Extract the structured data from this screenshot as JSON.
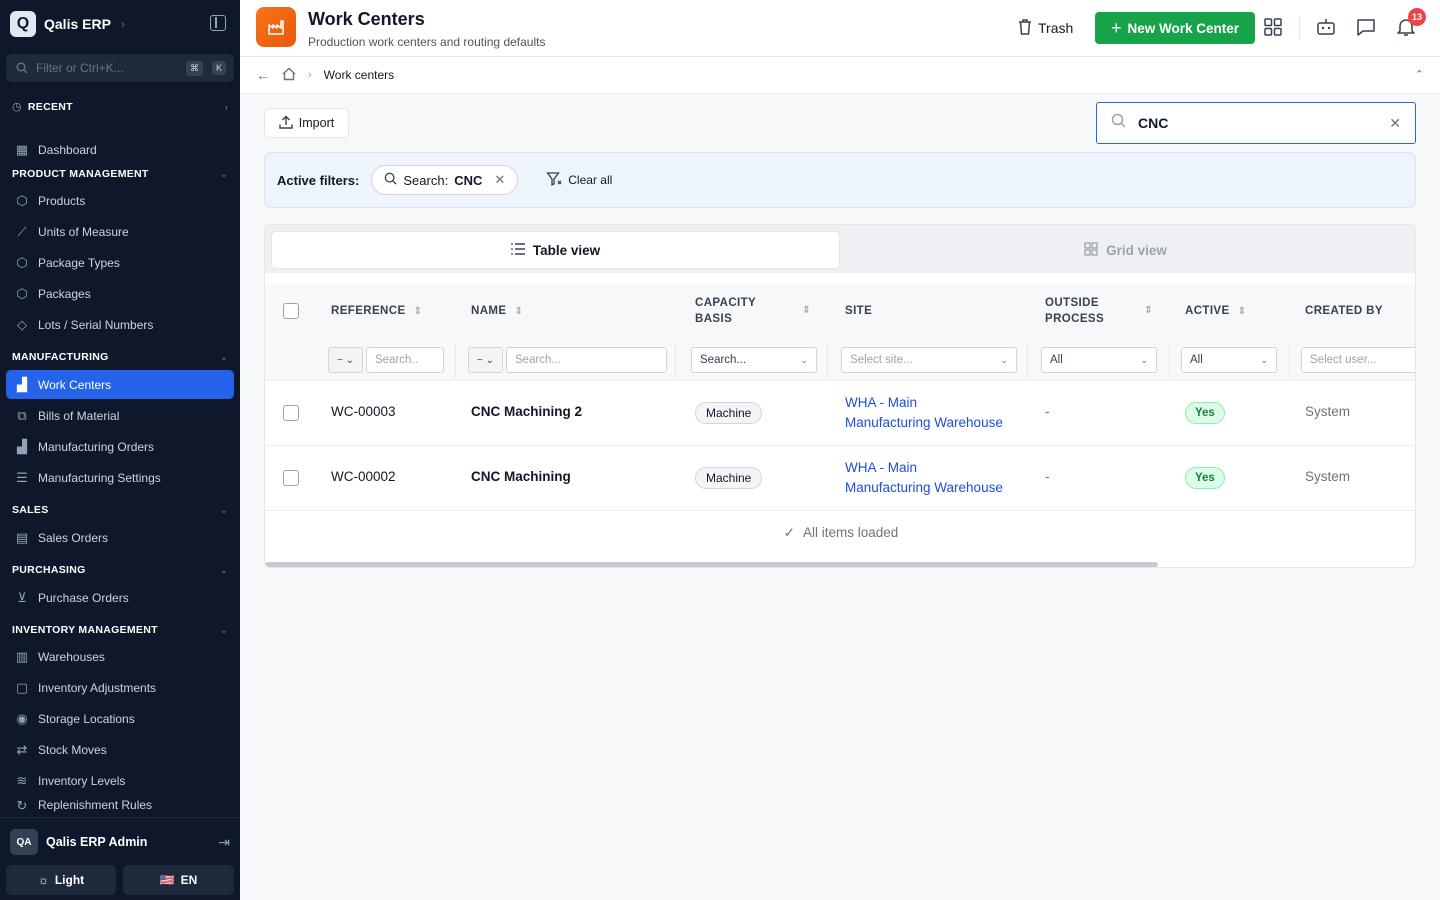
{
  "sidebar": {
    "brand_initial": "Q",
    "brand_name": "Qalis ERP",
    "filter_placeholder": "Filter or Ctrl+K...",
    "kbd_1": "⌘",
    "kbd_2": "K",
    "recent_label": "RECENT",
    "dashboard_label": "Dashboard",
    "sections": {
      "product": "PRODUCT MANAGEMENT",
      "manufacturing": "MANUFACTURING",
      "sales": "SALES",
      "purchasing": "PURCHASING",
      "inventory": "INVENTORY MANAGEMENT"
    },
    "items": {
      "products": "Products",
      "uom": "Units of Measure",
      "package_types": "Package Types",
      "packages": "Packages",
      "lots": "Lots / Serial Numbers",
      "work_centers": "Work Centers",
      "bom": "Bills of Material",
      "mo": "Manufacturing Orders",
      "mfg_settings": "Manufacturing Settings",
      "sales_orders": "Sales Orders",
      "purchase_orders": "Purchase Orders",
      "warehouses": "Warehouses",
      "inv_adjust": "Inventory Adjustments",
      "storage": "Storage Locations",
      "stock_moves": "Stock Moves",
      "inv_levels": "Inventory Levels",
      "replenish": "Replenishment Rules"
    },
    "user_initials": "QA",
    "user_name": "Qalis ERP Admin",
    "theme_label": "Light",
    "lang_flag": "🇺🇸",
    "lang_label": "EN"
  },
  "header": {
    "title": "Work Centers",
    "subtitle": "Production work centers and routing defaults",
    "trash_label": "Trash",
    "new_label": "New Work Center",
    "notif_count": "13"
  },
  "breadcrumb": {
    "current": "Work centers"
  },
  "toolbar": {
    "import_label": "Import",
    "search_value": "CNC"
  },
  "filters": {
    "label": "Active filters:",
    "chip_key": "Search:",
    "chip_value": "CNC",
    "clear_label": "Clear all"
  },
  "views": {
    "table": "Table view",
    "grid": "Grid view"
  },
  "table": {
    "columns": {
      "reference": "REFERENCE",
      "name": "NAME",
      "capacity_1": "CAPACITY",
      "capacity_2": "BASIS",
      "site": "SITE",
      "outside_1": "OUTSIDE",
      "outside_2": "PROCESS",
      "active": "ACTIVE",
      "created_by": "CREATED BY"
    },
    "filters": {
      "op": "~",
      "ref_placeholder": "Search..",
      "name_placeholder": "Search...",
      "capacity_value": "Search...",
      "site_placeholder": "Select site...",
      "outside_value": "All",
      "active_value": "All",
      "user_placeholder": "Select user..."
    },
    "rows": [
      {
        "reference": "WC-00003",
        "name": "CNC Machining 2",
        "capacity": "Machine",
        "site_1": "WHA - Main",
        "site_2": "Manufacturing Warehouse",
        "outside": "-",
        "active": "Yes",
        "created_by": "System"
      },
      {
        "reference": "WC-00002",
        "name": "CNC Machining",
        "capacity": "Machine",
        "site_1": "WHA - Main",
        "site_2": "Manufacturing Warehouse",
        "outside": "-",
        "active": "Yes",
        "created_by": "System"
      }
    ],
    "loaded_label": "All items loaded"
  },
  "colors": {
    "sidebar_bg": "#0f172a",
    "accent": "#2563eb",
    "primary_action": "#16a34a",
    "page_icon": "#f97316",
    "badge": "#ef4444"
  }
}
